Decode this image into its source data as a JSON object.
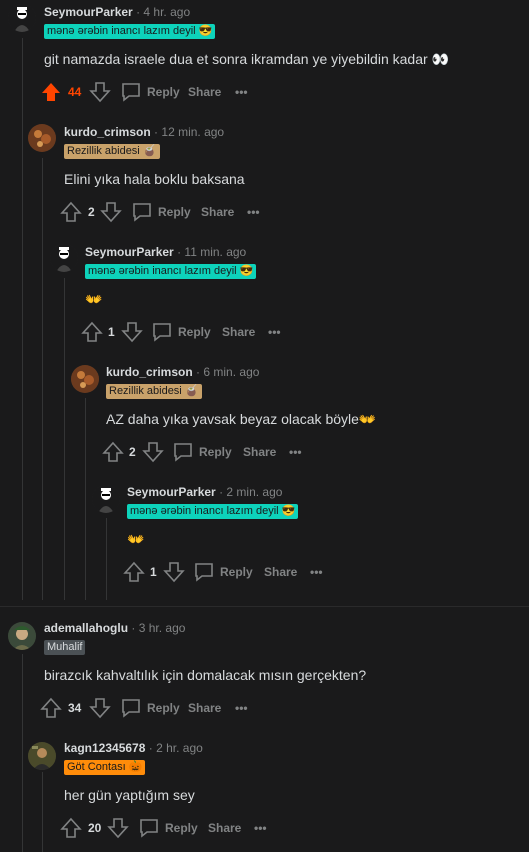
{
  "colors": {
    "background": "#1a1a1b",
    "text": "#d7dadc",
    "muted": "#818384",
    "upvote": "#ff4500",
    "thread_line": "#343536"
  },
  "comments": [
    {
      "user": "SeymourParker",
      "time": "4 hr. ago",
      "flair": "mənə ərəbin inancı lazım deyil 😎",
      "body": "git namazda israele dua et sonra ikramdan ye yiyebildin kadar 👀",
      "score": "44",
      "reply": "Reply",
      "share": "Share",
      "more": "•••"
    },
    {
      "user": "kurdo_crimson",
      "time": "12 min. ago",
      "flair": "Rezillik abidesi 🧉",
      "body": "Elini yıka hala boklu baksana",
      "score": "2",
      "reply": "Reply",
      "share": "Share",
      "more": "•••"
    },
    {
      "user": "SeymourParker",
      "time": "11 min. ago",
      "flair": "mənə ərəbin inancı lazım deyil 😎",
      "body": "👐",
      "score": "1",
      "reply": "Reply",
      "share": "Share",
      "more": "•••"
    },
    {
      "user": "kurdo_crimson",
      "time": "6 min. ago",
      "flair": "Rezillik abidesi 🧉",
      "body": "AZ daha yıka yavsak beyaz olacak böyle👐",
      "score": "2",
      "reply": "Reply",
      "share": "Share",
      "more": "•••"
    },
    {
      "user": "SeymourParker",
      "time": "2 min. ago",
      "flair": "mənə ərəbin inancı lazım deyil 😎",
      "body": "👐",
      "score": "1",
      "reply": "Reply",
      "share": "Share",
      "more": "•••"
    },
    {
      "user": "ademallahoglu",
      "time": "3 hr. ago",
      "flair": "Muhalif",
      "body": "birazcık kahvaltılık için domalacak mısın gerçekten?",
      "score": "34",
      "reply": "Reply",
      "share": "Share",
      "more": "•••"
    },
    {
      "user": "kagn12345678",
      "time": "2 hr. ago",
      "flair": "Göt Contası 🎃",
      "body": "her gün yaptığım sey",
      "score": "20",
      "reply": "Reply",
      "share": "Share",
      "more": "•••"
    }
  ],
  "dot": "·"
}
